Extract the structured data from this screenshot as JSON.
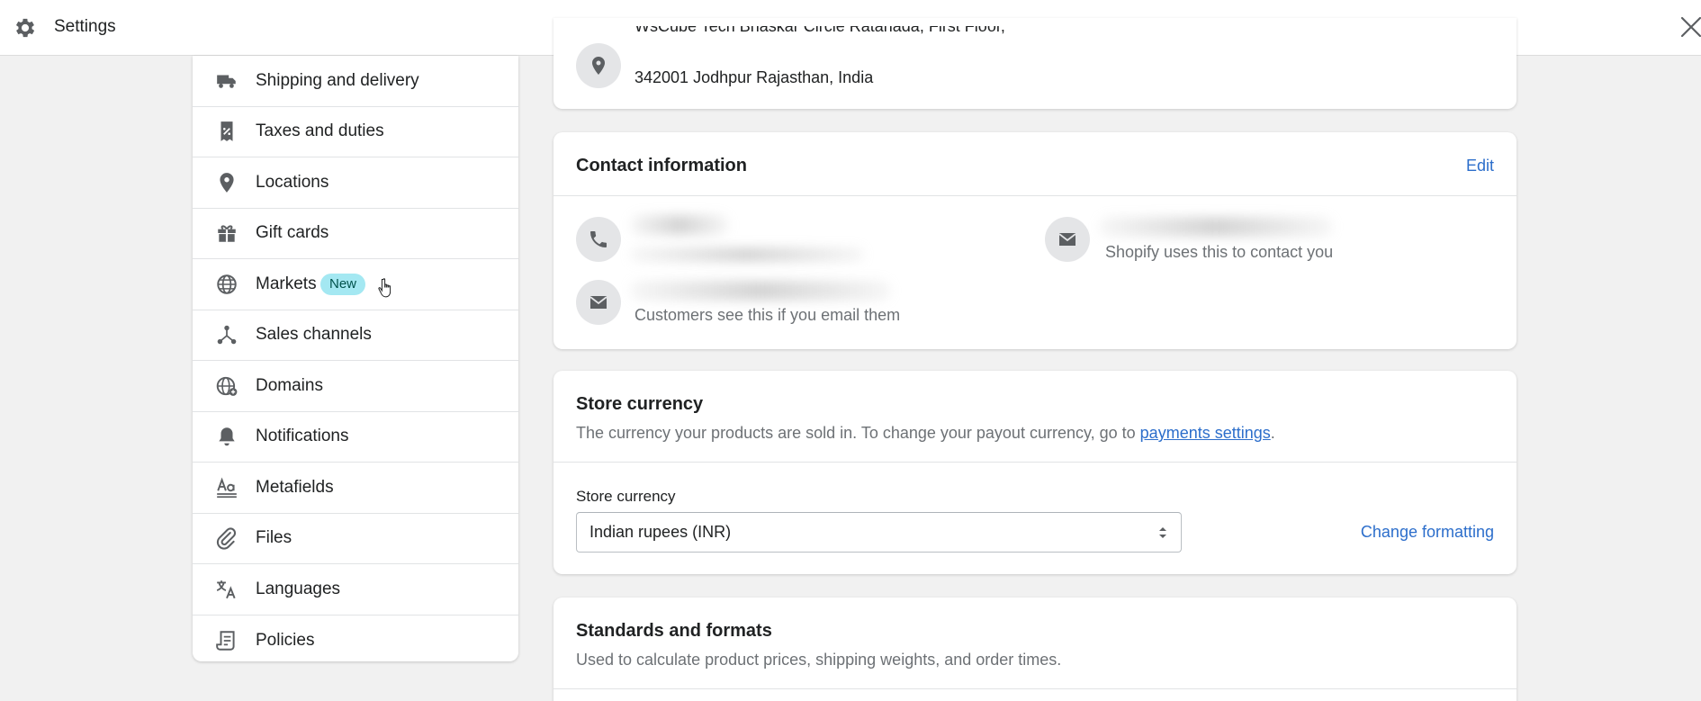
{
  "topbar": {
    "title": "Settings"
  },
  "sidebar": {
    "items": [
      {
        "label": "Shipping and delivery",
        "icon": "truck-icon"
      },
      {
        "label": "Taxes and duties",
        "icon": "receipt-icon"
      },
      {
        "label": "Locations",
        "icon": "location-icon"
      },
      {
        "label": "Gift cards",
        "icon": "gift-icon"
      },
      {
        "label": "Markets",
        "icon": "globe-icon",
        "badge": "New"
      },
      {
        "label": "Sales channels",
        "icon": "channels-icon"
      },
      {
        "label": "Domains",
        "icon": "globe-domain-icon"
      },
      {
        "label": "Notifications",
        "icon": "bell-icon"
      },
      {
        "label": "Metafields",
        "icon": "metafields-icon"
      },
      {
        "label": "Files",
        "icon": "paperclip-icon"
      },
      {
        "label": "Languages",
        "icon": "translate-icon"
      },
      {
        "label": "Policies",
        "icon": "policy-icon"
      }
    ]
  },
  "address": {
    "line1": "WsCube Tech Bhaskar Circle Ratanada, First Floor,",
    "line2": "342001 Jodhpur Rajasthan, India"
  },
  "contact": {
    "title": "Contact information",
    "edit_label": "Edit",
    "email_help": "Shopify uses this to contact you",
    "sender_help": "Customers see this if you email them"
  },
  "currency": {
    "title": "Store currency",
    "subtitle_prefix": "The currency your products are sold in. To change your payout currency, go to ",
    "subtitle_link": "payments settings",
    "subtitle_suffix": ".",
    "field_label": "Store currency",
    "selected": "Indian rupees (INR)",
    "change_formatting": "Change formatting"
  },
  "standards": {
    "title": "Standards and formats",
    "subtitle": "Used to calculate product prices, shipping weights, and order times."
  },
  "colors": {
    "link": "#2c6ecb",
    "badge_bg": "#a4e8f2",
    "icon": "#5c5f62"
  }
}
